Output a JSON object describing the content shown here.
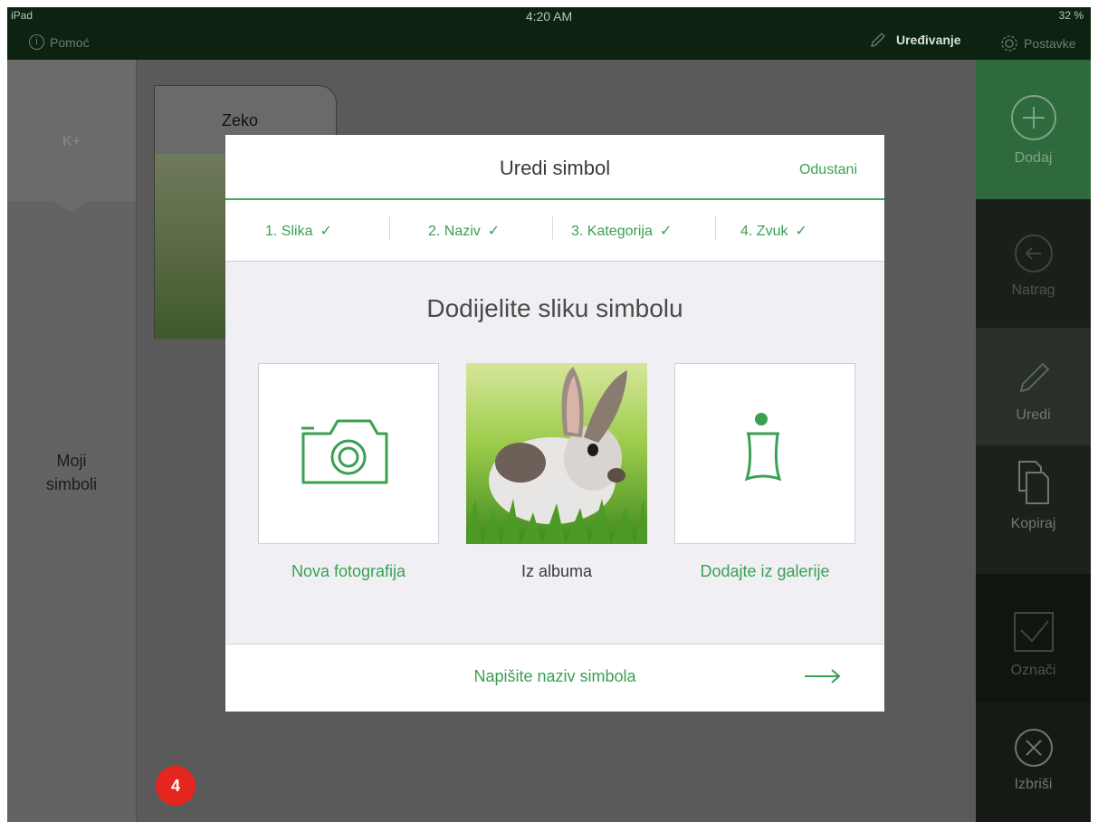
{
  "status_bar": {
    "carrier": "iPad",
    "time": "4:20 AM",
    "battery": "32 %",
    "help_label": "Pomoć",
    "edit_label": "Uređivanje",
    "settings_label": "Postavke"
  },
  "background": {
    "category_label": "K+",
    "my_symbols": "Moji simboli",
    "card_title": "Zeko",
    "badge": "4"
  },
  "toolbar": {
    "add": "Dodaj",
    "back": "Natrag",
    "edit": "Uredi",
    "copy": "Kopiraj",
    "select": "Označi",
    "delete": "Izbriši"
  },
  "modal": {
    "title": "Uredi simbol",
    "cancel": "Odustani",
    "steps": [
      {
        "label": "1. Slika"
      },
      {
        "label": "2. Naziv"
      },
      {
        "label": "3. Kategorija"
      },
      {
        "label": "4. Zvuk"
      }
    ],
    "heading": "Dodijelite sliku simbolu",
    "options": {
      "new_photo": "Nova fotografija",
      "from_album": "Iz albuma",
      "from_gallery": "Dodajte iz galerije"
    },
    "footer_next": "Napišite naziv simbola"
  },
  "colors": {
    "accent": "#3aa053",
    "dark_bar": "#0d2311",
    "badge": "#e4261e"
  }
}
